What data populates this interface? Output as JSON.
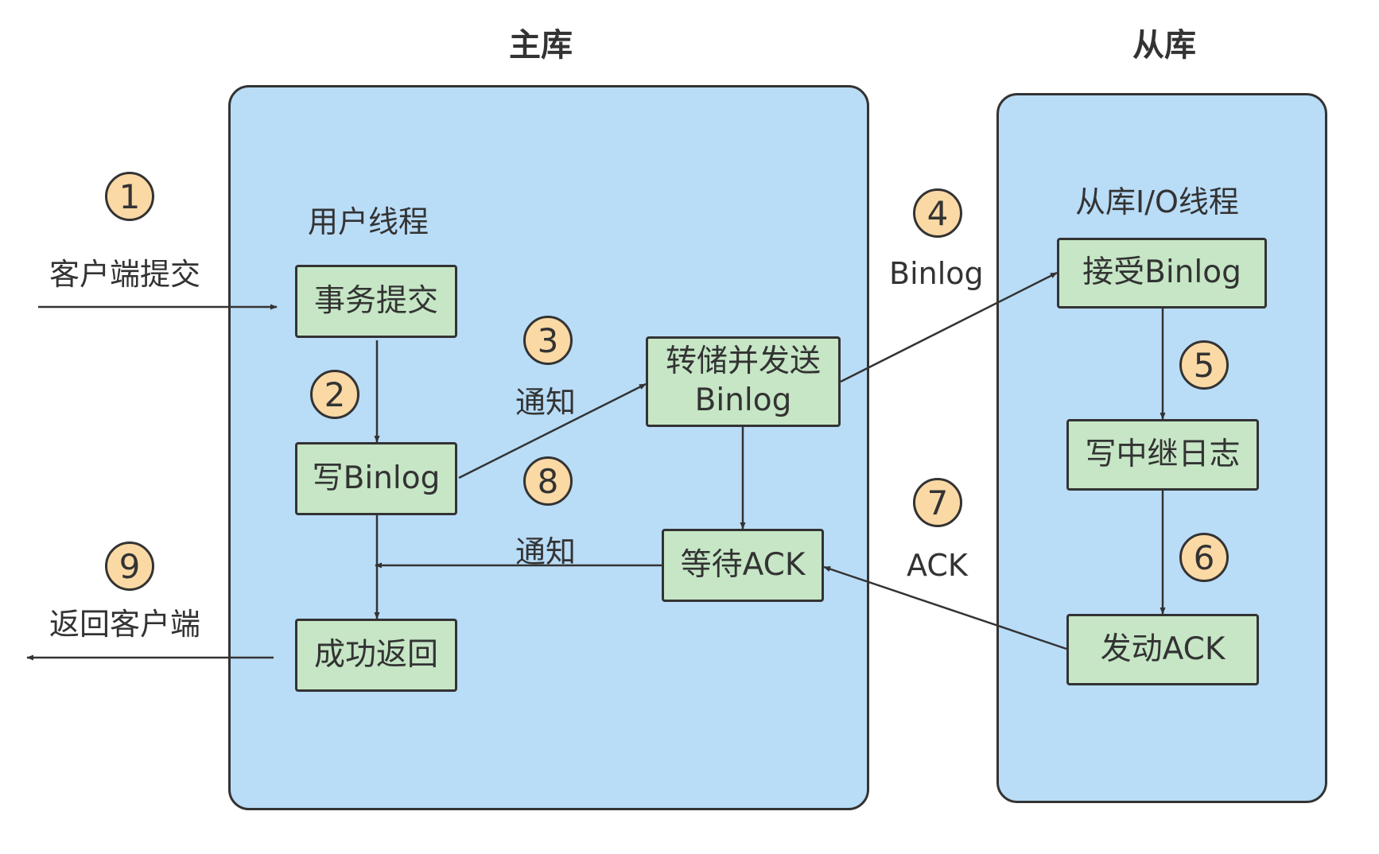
{
  "titles": {
    "master": "主库",
    "slave": "从库"
  },
  "section_labels": {
    "user_thread": "用户线程",
    "slave_io_thread": "从库I/O线程"
  },
  "nodes": {
    "commit": "事务提交",
    "write_binlog": "写Binlog",
    "success": "成功返回",
    "dump": "转储并发送\nBinlog",
    "wait_ack": "等待ACK",
    "receive": "接受Binlog",
    "write_relay": "写中继日志",
    "send_ack": "发动ACK"
  },
  "edge_labels": {
    "client_submit": "客户端提交",
    "notify_1": "通知",
    "notify_2": "通知",
    "binlog": "Binlog",
    "ack": "ACK",
    "return_client": "返回客户端"
  },
  "steps": [
    "1",
    "2",
    "3",
    "4",
    "5",
    "6",
    "7",
    "8",
    "9"
  ],
  "colors": {
    "container_fill": "#b9dcf7",
    "node_fill": "#c6e6c6",
    "badge_fill": "#fbd9a5",
    "stroke": "#333333"
  }
}
